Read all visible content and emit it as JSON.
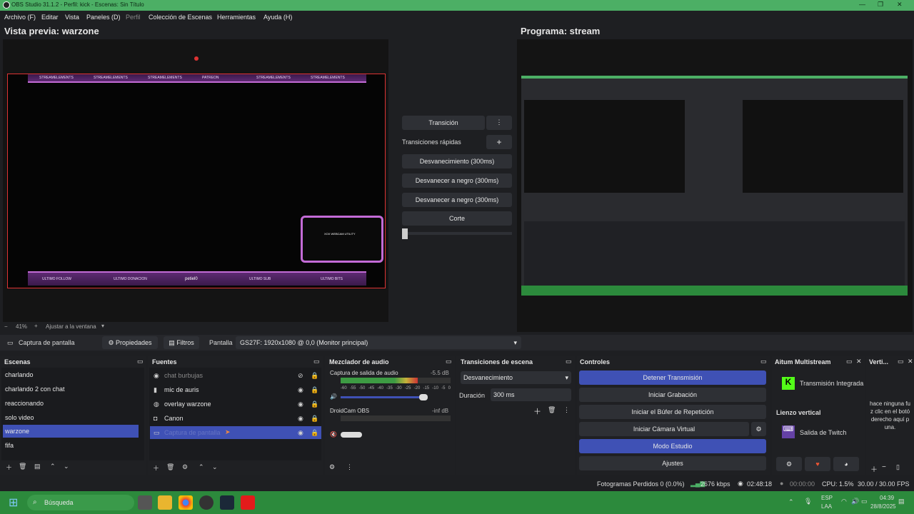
{
  "window": {
    "title": "OBS Studio 31.1.2 - Perfil: kick - Escenas: Sin Título"
  },
  "menu": [
    "Archivo (F)",
    "Editar",
    "Vista",
    "Paneles (D)",
    "Perfil",
    "Colección de Escenas",
    "Herramientas",
    "Ayuda (H)"
  ],
  "preview": {
    "title": "Vista previa: warzone",
    "zoom": "41%",
    "fit": "Ajustar a la ventana",
    "overlay_top": [
      "STREAMELEMENTS",
      "STREAMELEMENTS",
      "STREAMELEMENTS",
      "PATREON",
      "STREAMELEMENTS",
      "STREAMELEMENTS"
    ],
    "overlay_bottom": [
      "ULTIMO FOLLOW",
      "ULTIMO DONACION",
      "petiel0",
      "ULTIMO SUB",
      "ULTIMO BITS"
    ],
    "cam_label": "XOX WEBCAM UTILITY"
  },
  "program": {
    "title": "Programa: stream"
  },
  "transition": {
    "button": "Transición",
    "quick_label": "Transiciones rápidas",
    "options": [
      "Desvanecimiento (300ms)",
      "Desvanecer a negro (300ms)",
      "Desvanecer a negro (300ms)",
      "Corte"
    ]
  },
  "toolbar": {
    "source_name": "Captura de pantalla",
    "properties": "Propiedades",
    "filters": "Filtros",
    "display_label": "Pantalla",
    "display_value": "GS27F: 1920x1080 @ 0,0 (Monitor principal)"
  },
  "scenes": {
    "header": "Escenas",
    "items": [
      "charlando",
      "charlando 2 con chat",
      "reaccionando",
      "solo video",
      "warzone",
      "fifa"
    ],
    "selected": 4
  },
  "sources": {
    "header": "Fuentes",
    "items": [
      "chat burbujas",
      "mic de auris",
      "overlay warzone",
      "Canon",
      "Captura de pantalla"
    ],
    "selected": 4
  },
  "mixer": {
    "header": "Mezclador de audio",
    "channels": [
      {
        "name": "Captura de salida de audio",
        "db": "-5.5 dB",
        "level": 0.7
      },
      {
        "name": "DroidCam OBS",
        "db": "-inf dB",
        "level": 0.0
      }
    ],
    "ticks": [
      "-60",
      "-55",
      "-50",
      "-45",
      "-40",
      "-35",
      "-30",
      "-25",
      "-20",
      "-15",
      "-10",
      "-5",
      "0"
    ]
  },
  "scene_transitions": {
    "header": "Transiciones de escena",
    "type": "Desvanecimiento",
    "duration_label": "Duración",
    "duration": "300 ms"
  },
  "controls": {
    "header": "Controles",
    "buttons": [
      "Detener Transmisión",
      "Iniciar Grabación",
      "Iniciar el Búfer de Repetición",
      "Iniciar Cámara Virtual",
      "Modo Estudio",
      "Ajustes"
    ]
  },
  "multistream": {
    "header": "Aitum Multistream",
    "integrated": "Transmisión Integrada",
    "vertical_label": "Lienzo vertical",
    "twitch": "Salida de Twitch"
  },
  "vertical": {
    "header": "Verti...",
    "text": "hace ninguna fu z clic en el botó derecho aquí p una."
  },
  "status": {
    "dropped": "Fotogramas Perdidos 0 (0.0%)",
    "bitrate": "2676 kbps",
    "stream_time": "02:48:18",
    "rec_time": "00:00:00",
    "cpu": "CPU: 1.5%",
    "fps": "30.00 / 30.00 FPS"
  },
  "taskbar": {
    "search": "Búsqueda",
    "lang": "ESP",
    "lang2": "LAA",
    "time": "04:39",
    "date": "28/8/2025"
  },
  "colors": {
    "accent": "#3f51b5",
    "green": "#4caf65",
    "overlay": "#c36bd6"
  }
}
